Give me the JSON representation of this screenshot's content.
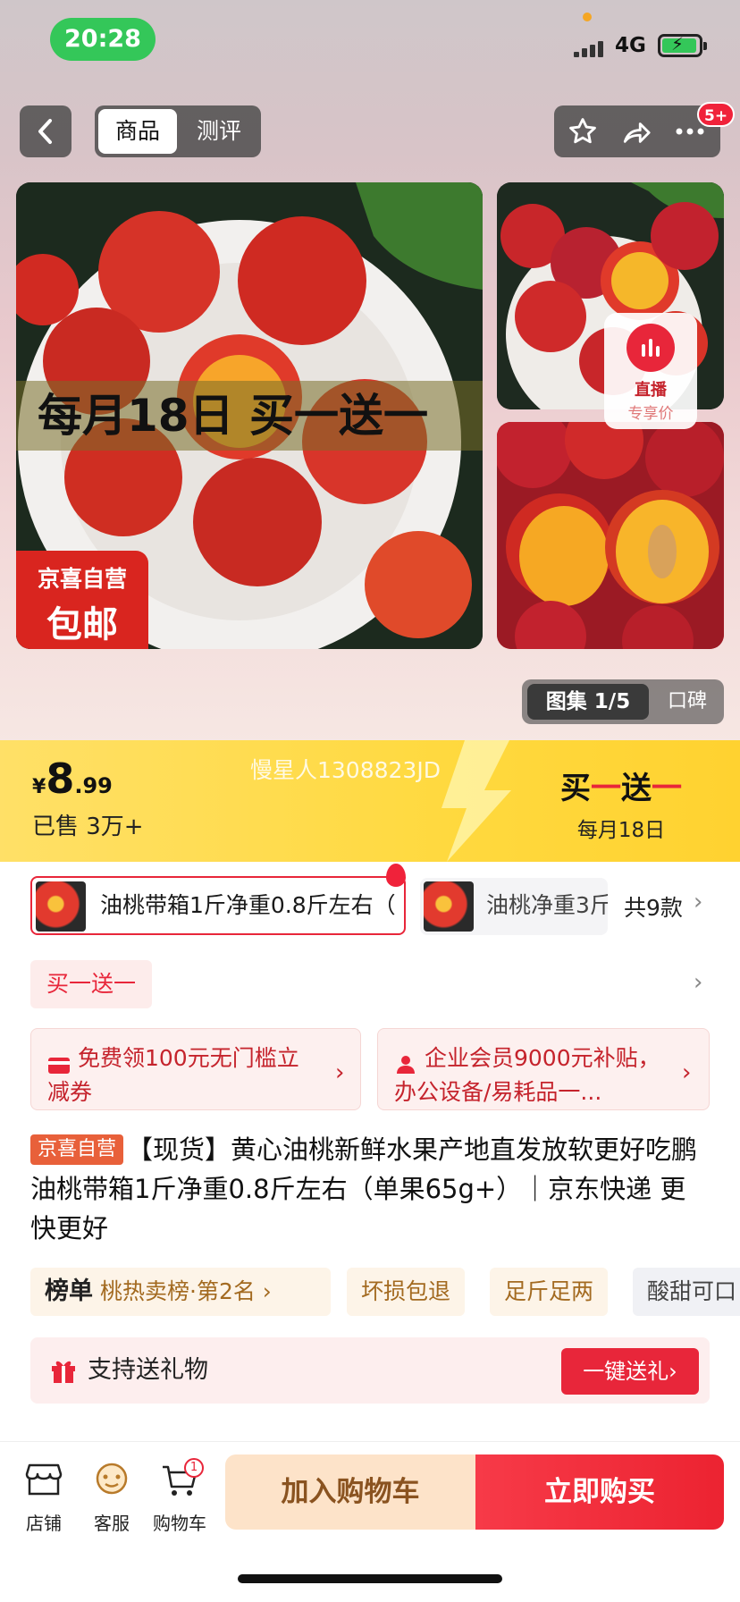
{
  "status_bar": {
    "time": "20:28",
    "network": "4G"
  },
  "header": {
    "tabs": [
      {
        "label": "商品"
      },
      {
        "label": "测评"
      }
    ],
    "more_badge": "5+"
  },
  "gallery": {
    "main_banner": "每月18日 买一送一",
    "badge_line1": "京喜自营",
    "badge_line2": "包邮",
    "live_label1": "直播",
    "live_label2": "专享价",
    "gallery_tab": "图集 1/5",
    "reviews_tab": "口碑"
  },
  "price": {
    "currency": "¥",
    "integer": "8",
    "decimal": ".99",
    "sold": "已售 3万+",
    "watermark": "慢星人1308823JD",
    "promo_prefix": "买",
    "promo_mid": "一",
    "promo_word": "送",
    "promo_suffix": "一",
    "promo_date": "每月18日"
  },
  "variants": {
    "items": [
      {
        "label": "油桃带箱1斤净重0.8斤左右（"
      },
      {
        "label": "油桃净重3斤"
      }
    ],
    "total": "共9款"
  },
  "promotion_tag": "买一送一",
  "coupons": [
    {
      "text": "免费领100元无门槛立减券"
    },
    {
      "text": "企业会员9000元补贴，办公设备/易耗品一..."
    }
  ],
  "product": {
    "store_tag": "京喜自营",
    "title": "【现货】黄心油桃新鲜水果产地直发放软更好吃鹏 油桃带箱1斤净重0.8斤左右（单果65g+）｜京东快递 更快更好"
  },
  "chips": {
    "rank_label": "榜单",
    "rank_text": "桃热卖榜·第2名 ›",
    "items": [
      {
        "label": "坏损包退"
      },
      {
        "label": "足斤足两"
      },
      {
        "label": "酸甜可口"
      }
    ]
  },
  "gift": {
    "label": "支持送礼物",
    "button": "一键送礼›"
  },
  "bottom_bar": {
    "store": "店铺",
    "service": "客服",
    "cart": "购物车",
    "cart_count": "1",
    "add_to_cart": "加入购物车",
    "buy_now": "立即购买"
  },
  "colors": {
    "accent_red": "#e8263a",
    "price_band": "#ffd93f",
    "status_green": "#34c759"
  }
}
